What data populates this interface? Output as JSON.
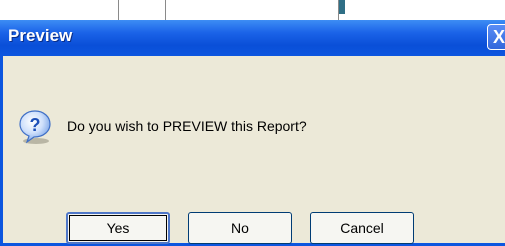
{
  "dialog": {
    "title": "Preview",
    "close_glyph": "X",
    "message": "Do you wish to PREVIEW this Report?",
    "icon": "question-icon"
  },
  "buttons": {
    "yes": "Yes",
    "no": "No",
    "cancel": "Cancel"
  },
  "colors": {
    "titlebar": "#0c56df",
    "dialog_bg": "#ece9d8",
    "icon_blue": "#2d6fd6"
  }
}
